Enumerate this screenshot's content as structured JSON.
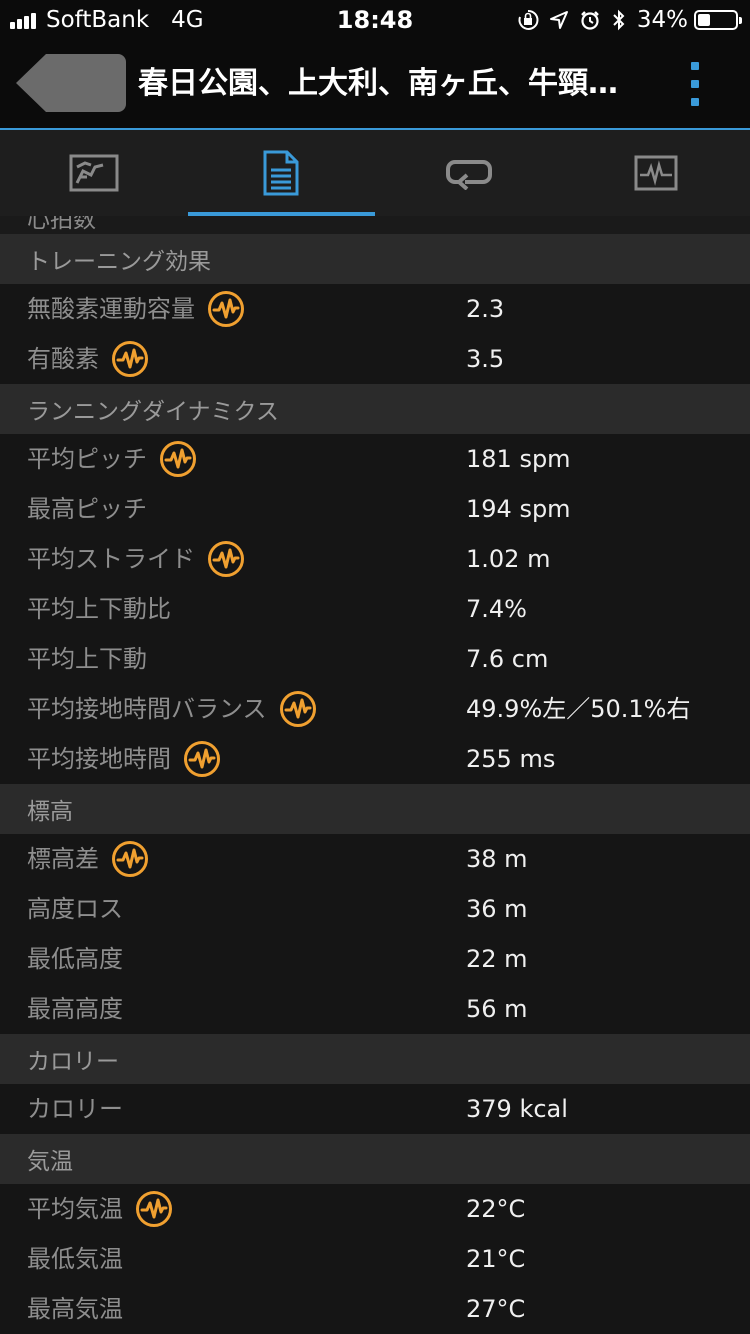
{
  "status": {
    "carrier": "SoftBank",
    "network": "4G",
    "time": "18:48",
    "battery": "34%"
  },
  "header": {
    "title": "春日公園、上大利、南ヶ丘、牛頸…"
  },
  "tabs": [
    {
      "name": "map-tab",
      "icon": "map-icon",
      "active": false
    },
    {
      "name": "details-tab",
      "icon": "document-icon",
      "active": true
    },
    {
      "name": "laps-tab",
      "icon": "loop-icon",
      "active": false
    },
    {
      "name": "charts-tab",
      "icon": "chart-icon",
      "active": false
    }
  ],
  "partial_label": "心拍数",
  "sections": [
    {
      "title": "トレーニング効果",
      "rows": [
        {
          "label": "無酸素運動容量",
          "value": "2.3",
          "icon": true
        },
        {
          "label": "有酸素",
          "value": "3.5",
          "icon": true
        }
      ]
    },
    {
      "title": "ランニングダイナミクス",
      "rows": [
        {
          "label": "平均ピッチ",
          "value": "181 spm",
          "icon": true
        },
        {
          "label": "最高ピッチ",
          "value": "194 spm",
          "icon": false
        },
        {
          "label": "平均ストライド",
          "value": "1.02 m",
          "icon": true
        },
        {
          "label": "平均上下動比",
          "value": "7.4%",
          "icon": false
        },
        {
          "label": "平均上下動",
          "value": "7.6 cm",
          "icon": false
        },
        {
          "label": "平均接地時間バランス",
          "value": "49.9%左／50.1%右",
          "icon": true
        },
        {
          "label": "平均接地時間",
          "value": "255 ms",
          "icon": true
        }
      ]
    },
    {
      "title": "標高",
      "rows": [
        {
          "label": "標高差",
          "value": "38 m",
          "icon": true
        },
        {
          "label": "高度ロス",
          "value": "36 m",
          "icon": false
        },
        {
          "label": "最低高度",
          "value": "22 m",
          "icon": false
        },
        {
          "label": "最高高度",
          "value": "56 m",
          "icon": false
        }
      ]
    },
    {
      "title": "カロリー",
      "rows": [
        {
          "label": "カロリー",
          "value": "379 kcal",
          "icon": false
        }
      ]
    },
    {
      "title": "気温",
      "rows": [
        {
          "label": "平均気温",
          "value": "22°C",
          "icon": true
        },
        {
          "label": "最低気温",
          "value": "21°C",
          "icon": false
        },
        {
          "label": "最高気温",
          "value": "27°C",
          "icon": false
        }
      ]
    }
  ],
  "colors": {
    "accent": "#3a9ad9",
    "pulse_icon": "#f0a030"
  }
}
